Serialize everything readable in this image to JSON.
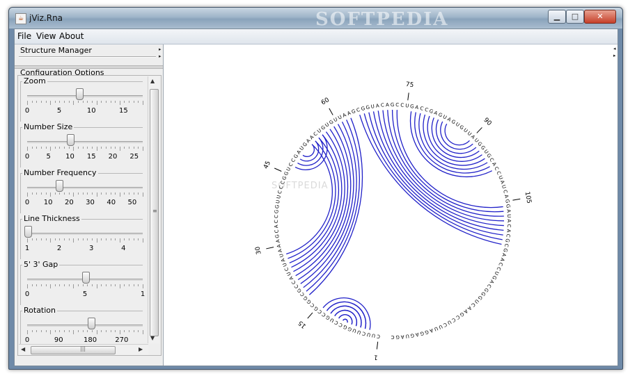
{
  "window": {
    "title": "jViz.Rna",
    "watermark": "SOFTPEDIA",
    "app_icon": "java-cup-icon",
    "controls": {
      "minimize": "minimize-icon",
      "maximize": "maximize-icon",
      "close": "close-icon"
    }
  },
  "menubar": {
    "file": "File",
    "view": "View",
    "about": "About"
  },
  "structure_manager": {
    "title": "Structure Manager"
  },
  "configuration": {
    "title": "Configuration Options",
    "sliders": [
      {
        "label": "Zoom",
        "value": 8,
        "min": 0,
        "max": 18,
        "ticks": [
          "0",
          "5",
          "10",
          "15"
        ]
      },
      {
        "label": "Number Size",
        "value": 10,
        "min": 0,
        "max": 27,
        "ticks": [
          "0",
          "5",
          "10",
          "15",
          "20",
          "25"
        ]
      },
      {
        "label": "Number Frequency",
        "value": 15,
        "min": 0,
        "max": 55,
        "ticks": [
          "0",
          "10",
          "20",
          "30",
          "40",
          "50"
        ]
      },
      {
        "label": "Line Thickness",
        "value": 1,
        "min": 1,
        "max": 4.6,
        "ticks": [
          "1",
          "2",
          "3",
          "4"
        ]
      },
      {
        "label": "5' 3' Gap",
        "value": 5,
        "min": 0,
        "max": 10,
        "ticks": [
          "0",
          "5",
          "1"
        ]
      },
      {
        "label": "Rotation",
        "value": 180,
        "min": 0,
        "max": 330,
        "ticks": [
          "0",
          "90",
          "180",
          "270"
        ]
      }
    ]
  },
  "canvas": {
    "watermark": "SOFTPEDIA",
    "sequence": "CUUCUUGGCCUGCCGCGGCGCCAUCUAUAAAGCACCGGUUCCCGGUCCGAUGAACUGUGUUAAGCGGUACAGCCUGACCGAGUAGUGUUAUGGUGCACCUAUCAGGAUACACGCGAACCUGACGGGUCAAGCCUCUUAGGAGUAGC",
    "index_labels": [
      "1",
      "15",
      "30",
      "45",
      "60",
      "75",
      "90",
      "105"
    ],
    "arc_color": "#2020c8",
    "helices": [
      {
        "i": 3,
        "j": 14,
        "n": 11
      },
      {
        "i": 18,
        "j": 63,
        "n": 11
      },
      {
        "i": 47,
        "j": 56,
        "n": 4
      },
      {
        "i": 65,
        "j": 114,
        "n": 9
      },
      {
        "i": 76,
        "j": 98,
        "n": 9
      }
    ]
  }
}
